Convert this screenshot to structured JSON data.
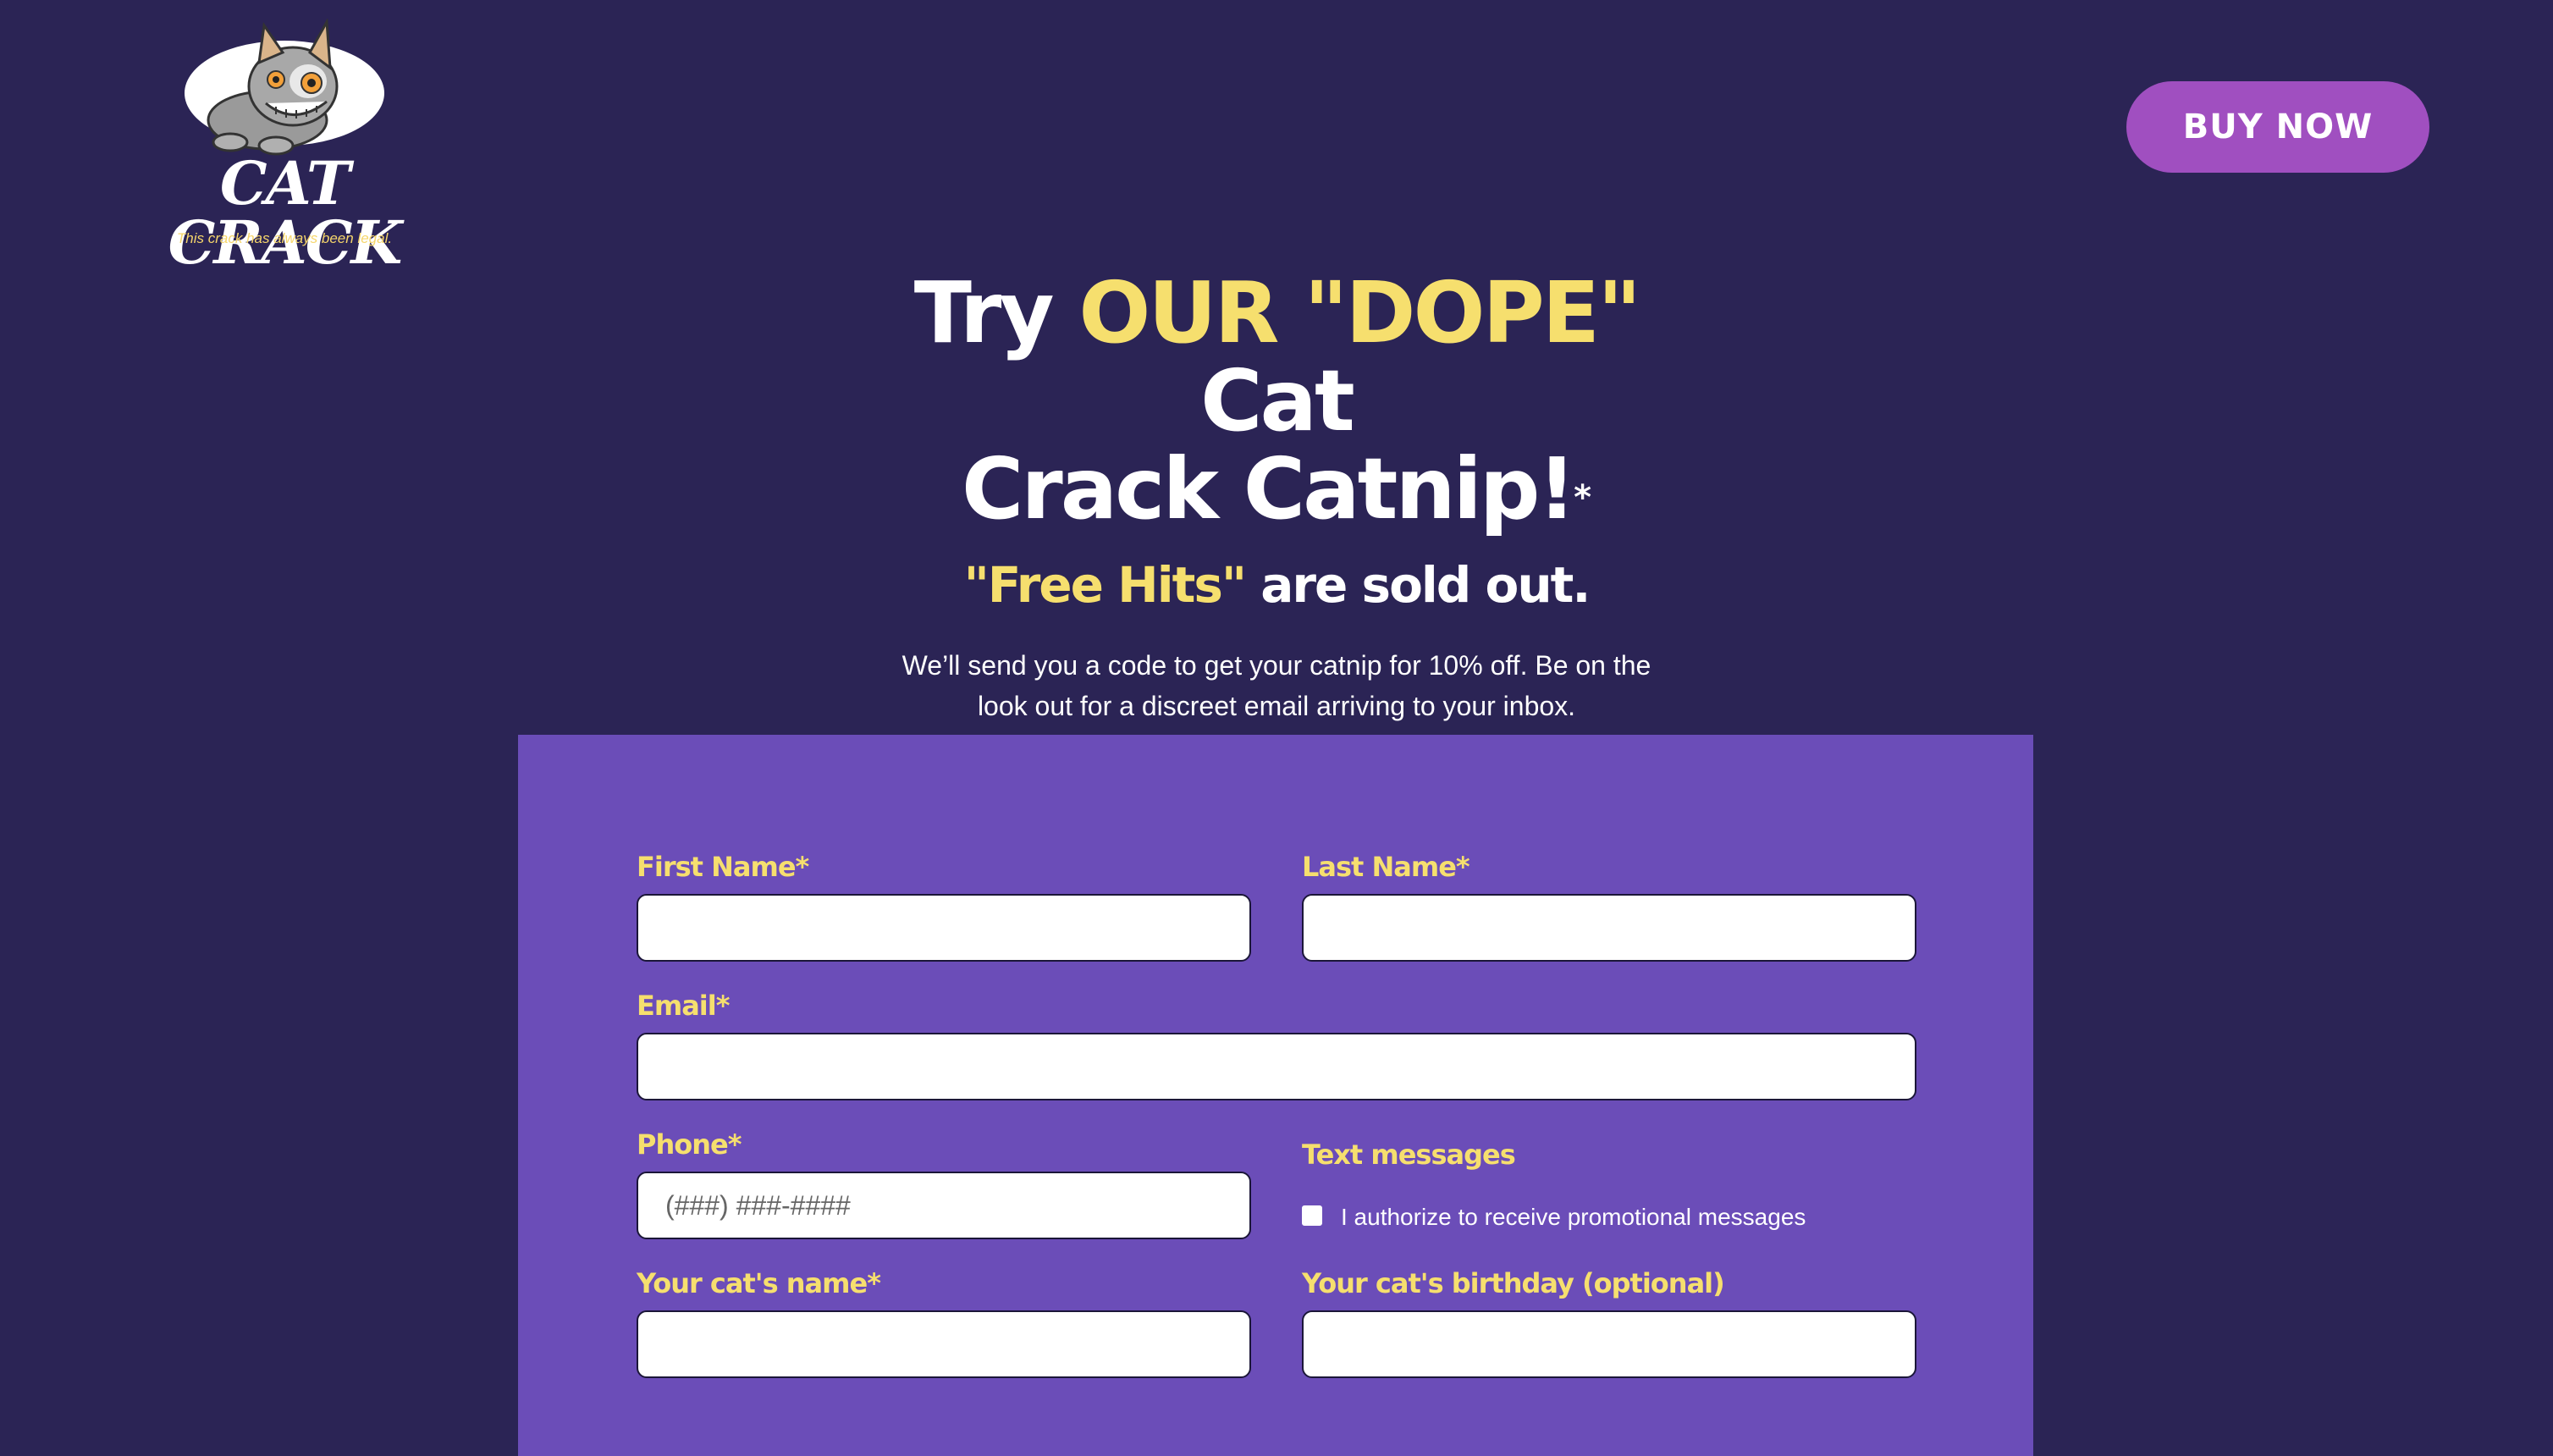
{
  "header": {
    "logo_text": "CAT CRACK",
    "logo_tagline": "This crack has always been legal.",
    "buy_button": "BUY NOW"
  },
  "hero": {
    "title_try": "Try ",
    "title_highlight": "OUR \"DOPE\"",
    "title_rest_line1": " Cat",
    "title_line2": "Crack Catnip!",
    "title_asterisk": "*",
    "sub_highlight": "\"Free Hits\"",
    "sub_rest": " are sold out.",
    "description": "We’ll send you a code to get your catnip for 10% off. Be on the look out for a discreet email arriving to your inbox."
  },
  "form": {
    "first_name_label": "First Name*",
    "last_name_label": "Last Name*",
    "email_label": "Email*",
    "phone_label": "Phone*",
    "phone_placeholder": "(###) ###-####",
    "text_messages_label": "Text messages",
    "text_messages_checkbox": "I authorize to receive promotional messages",
    "cat_name_label": "Your cat's name*",
    "cat_birthday_label": "Your cat's birthday (optional)"
  },
  "colors": {
    "background": "#2b2455",
    "card": "#6b4db8",
    "accent_yellow": "#f6df6e",
    "button": "#a04fc0"
  }
}
